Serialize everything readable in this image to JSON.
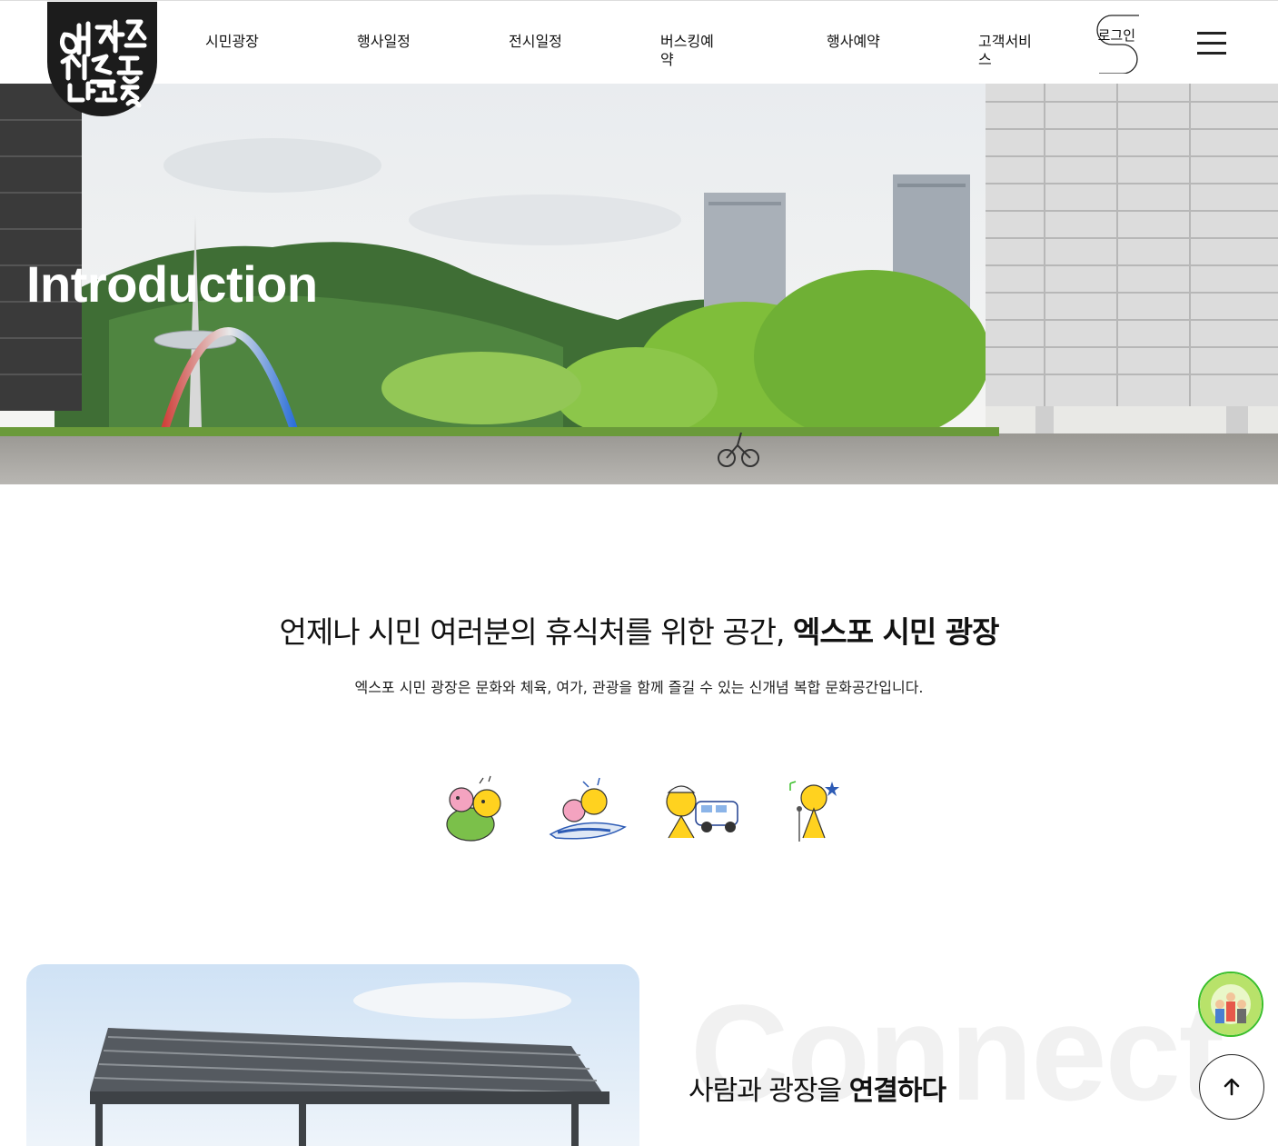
{
  "header": {
    "logo_text": "대전엑스포시민광장",
    "nav": [
      "시민광장",
      "행사일정",
      "전시일정",
      "버스킹예약",
      "행사예약",
      "고객서비스"
    ],
    "login_label": "로그인"
  },
  "hero": {
    "title": "Introduction"
  },
  "intro": {
    "heading_prefix": "언제나 시민 여러분의 휴식처를 위한 공간, ",
    "heading_bold": "엑스포 시민 광장",
    "subtitle": "엑스포 시민 광장은 문화와 체육, 여가, 관광을 함께 즐길 수 있는 신개념 복합 문화공간입니다."
  },
  "mascots": [
    "mascot-couple-icon",
    "mascot-airplane-icon",
    "mascot-police-icon",
    "mascot-singer-icon"
  ],
  "connect": {
    "watermark": "Connect",
    "title_prefix": "사람과 광장을 ",
    "title_bold": "연결하다"
  },
  "colors": {
    "accent_green": "#3bbf2a",
    "logo_bg": "#1c1c1c",
    "text": "#111111"
  }
}
